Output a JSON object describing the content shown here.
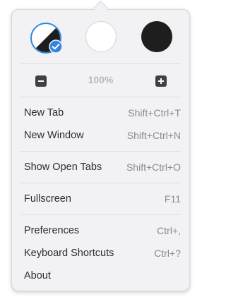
{
  "theme": {
    "options": [
      {
        "name": "Follow System Style",
        "fill": "split"
      },
      {
        "name": "Light Style",
        "fill": "#ffffff"
      },
      {
        "name": "Dark Style",
        "fill": "#1e1e1e"
      }
    ],
    "selected_index": 0,
    "accent_color": "#3584e4"
  },
  "zoom": {
    "value": "100%",
    "out_icon": "zoom-out-icon",
    "in_icon": "zoom-in-icon"
  },
  "menu": {
    "new_tab": {
      "label": "New Tab",
      "accel": "Shift+Ctrl+T"
    },
    "new_window": {
      "label": "New Window",
      "accel": "Shift+Ctrl+N"
    },
    "show_open_tabs": {
      "label": "Show Open Tabs",
      "accel": "Shift+Ctrl+O"
    },
    "fullscreen": {
      "label": "Fullscreen",
      "accel": "F11"
    },
    "preferences": {
      "label": "Preferences",
      "accel": "Ctrl+,"
    },
    "keyboard_shortcuts": {
      "label": "Keyboard Shortcuts",
      "accel": "Ctrl+?"
    },
    "about": {
      "label": "About",
      "accel": ""
    }
  }
}
